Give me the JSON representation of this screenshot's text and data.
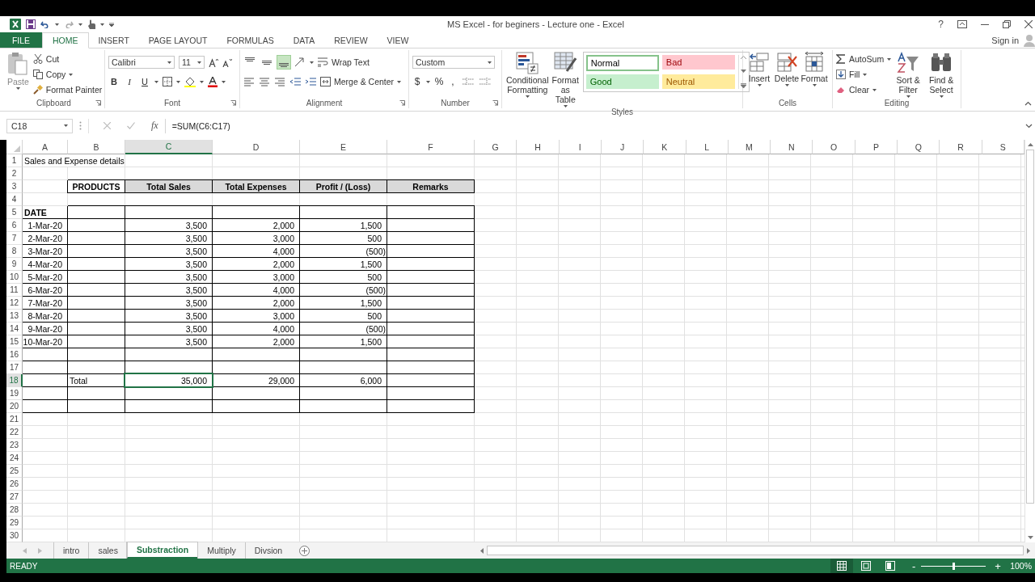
{
  "window": {
    "title": "MS Excel - for beginers - Lecture one - Excel",
    "help": "?",
    "sign_in": "Sign in"
  },
  "ribbon_tabs": [
    {
      "label": "FILE",
      "kind": "file",
      "selected": false
    },
    {
      "label": "HOME",
      "kind": "tab",
      "selected": true
    },
    {
      "label": "INSERT",
      "kind": "tab",
      "selected": false
    },
    {
      "label": "PAGE LAYOUT",
      "kind": "tab",
      "selected": false
    },
    {
      "label": "FORMULAS",
      "kind": "tab",
      "selected": false
    },
    {
      "label": "DATA",
      "kind": "tab",
      "selected": false
    },
    {
      "label": "REVIEW",
      "kind": "tab",
      "selected": false
    },
    {
      "label": "VIEW",
      "kind": "tab",
      "selected": false
    }
  ],
  "ribbon": [
    {
      "kind": "clipboard",
      "label": "Clipboard",
      "paste": "Paste",
      "cut": "Cut",
      "copy": "Copy",
      "format_painter": "Format Painter"
    },
    {
      "kind": "font",
      "label": "Font",
      "font": "Calibri",
      "size": "11",
      "styles": [
        "B",
        "I",
        "U"
      ]
    },
    {
      "kind": "alignment",
      "label": "Alignment",
      "vertical": [
        {
          "kind": "top",
          "selected": false
        },
        {
          "kind": "middle",
          "selected": false
        },
        {
          "kind": "bottom",
          "selected": true
        }
      ],
      "wrap": "Wrap Text",
      "merge": "Merge & Center"
    },
    {
      "kind": "number",
      "label": "Number",
      "format": "Custom",
      "symbols": [
        "$",
        "%",
        ","
      ]
    },
    {
      "kind": "styles",
      "label": "Styles",
      "conditional": "Conditional Formatting",
      "table": "Format as Table",
      "gallery": [
        {
          "text": "Normal",
          "kind": "normal",
          "selected": true
        },
        {
          "text": "Bad",
          "kind": "bad",
          "selected": false
        },
        {
          "text": "Good",
          "kind": "good",
          "selected": false
        },
        {
          "text": "Neutral",
          "kind": "neutral",
          "selected": false
        }
      ]
    },
    {
      "kind": "cells",
      "label": "Cells",
      "buttons": [
        {
          "text": "Insert",
          "kind": "insert"
        },
        {
          "text": "Delete",
          "kind": "delete"
        },
        {
          "text": "Format",
          "kind": "format"
        }
      ]
    },
    {
      "kind": "editing",
      "label": "Editing",
      "autosum": "AutoSum",
      "fill": "Fill",
      "clear": "Clear",
      "sort": "Sort & Filter",
      "find": "Find & Select"
    }
  ],
  "formula_bar": {
    "name_box": "C18",
    "fx": "fx",
    "formula": "=SUM(C6:C17)"
  },
  "sheet": {
    "columns": [
      {
        "label": "A",
        "selected": false
      },
      {
        "label": "B",
        "selected": false
      },
      {
        "label": "C",
        "selected": true
      },
      {
        "label": "D",
        "selected": false
      },
      {
        "label": "E",
        "selected": false
      },
      {
        "label": "F",
        "selected": false
      },
      {
        "label": "G",
        "selected": false
      },
      {
        "label": "H",
        "selected": false
      },
      {
        "label": "I",
        "selected": false
      },
      {
        "label": "J",
        "selected": false
      },
      {
        "label": "K",
        "selected": false
      },
      {
        "label": "L",
        "selected": false
      },
      {
        "label": "M",
        "selected": false
      },
      {
        "label": "N",
        "selected": false
      },
      {
        "label": "O",
        "selected": false
      },
      {
        "label": "P",
        "selected": false
      },
      {
        "label": "Q",
        "selected": false
      },
      {
        "label": "R",
        "selected": false
      },
      {
        "label": "S",
        "selected": false
      }
    ],
    "rows": [
      {
        "number": "1",
        "selected": false,
        "kind": "plain",
        "cells": [
          {
            "text": "Sales and Expense details",
            "kind": "label"
          }
        ]
      },
      {
        "number": "2",
        "selected": false,
        "kind": "plain"
      },
      {
        "number": "3",
        "selected": false,
        "kind": "header",
        "cells": [
          null,
          {
            "text": "PRODUCTS",
            "kind": "heading",
            "shaded": false
          },
          {
            "text": "Total Sales",
            "kind": "heading",
            "shaded": true
          },
          {
            "text": "Total Expenses",
            "kind": "heading",
            "shaded": true
          },
          {
            "text": "Profit / (Loss)",
            "kind": "heading",
            "shaded": true
          },
          {
            "text": "Remarks",
            "kind": "heading",
            "shaded": true
          }
        ]
      },
      {
        "number": "4",
        "selected": false,
        "kind": "plain"
      },
      {
        "number": "5",
        "selected": false,
        "kind": "boxed",
        "cells": [
          {
            "text": "DATE",
            "kind": "bold_label"
          }
        ]
      },
      {
        "number": "6",
        "selected": false,
        "kind": "boxed",
        "cells": [
          {
            "text": "1-Mar-20",
            "kind": "number"
          },
          null,
          {
            "text": "3,500",
            "kind": "number"
          },
          {
            "text": "2,000",
            "kind": "number"
          },
          {
            "text": "1,500",
            "kind": "number"
          }
        ]
      },
      {
        "number": "7",
        "selected": false,
        "kind": "boxed",
        "cells": [
          {
            "text": "2-Mar-20",
            "kind": "number"
          },
          null,
          {
            "text": "3,500",
            "kind": "number"
          },
          {
            "text": "3,000",
            "kind": "number"
          },
          {
            "text": "500",
            "kind": "number"
          }
        ]
      },
      {
        "number": "8",
        "selected": false,
        "kind": "boxed",
        "cells": [
          {
            "text": "3-Mar-20",
            "kind": "number"
          },
          null,
          {
            "text": "3,500",
            "kind": "number"
          },
          {
            "text": "4,000",
            "kind": "number"
          },
          {
            "text": "(500)",
            "kind": "negative"
          }
        ]
      },
      {
        "number": "9",
        "selected": false,
        "kind": "boxed",
        "cells": [
          {
            "text": "4-Mar-20",
            "kind": "number"
          },
          null,
          {
            "text": "3,500",
            "kind": "number"
          },
          {
            "text": "2,000",
            "kind": "number"
          },
          {
            "text": "1,500",
            "kind": "number"
          }
        ]
      },
      {
        "number": "10",
        "selected": false,
        "kind": "boxed",
        "cells": [
          {
            "text": "5-Mar-20",
            "kind": "number"
          },
          null,
          {
            "text": "3,500",
            "kind": "number"
          },
          {
            "text": "3,000",
            "kind": "number"
          },
          {
            "text": "500",
            "kind": "number"
          }
        ]
      },
      {
        "number": "11",
        "selected": false,
        "kind": "boxed",
        "cells": [
          {
            "text": "6-Mar-20",
            "kind": "number"
          },
          null,
          {
            "text": "3,500",
            "kind": "number"
          },
          {
            "text": "4,000",
            "kind": "number"
          },
          {
            "text": "(500)",
            "kind": "negative"
          }
        ]
      },
      {
        "number": "12",
        "selected": false,
        "kind": "boxed",
        "cells": [
          {
            "text": "7-Mar-20",
            "kind": "number"
          },
          null,
          {
            "text": "3,500",
            "kind": "number"
          },
          {
            "text": "2,000",
            "kind": "number"
          },
          {
            "text": "1,500",
            "kind": "number"
          }
        ]
      },
      {
        "number": "13",
        "selected": false,
        "kind": "boxed",
        "cells": [
          {
            "text": "8-Mar-20",
            "kind": "number"
          },
          null,
          {
            "text": "3,500",
            "kind": "number"
          },
          {
            "text": "3,000",
            "kind": "number"
          },
          {
            "text": "500",
            "kind": "number"
          }
        ]
      },
      {
        "number": "14",
        "selected": false,
        "kind": "boxed",
        "cells": [
          {
            "text": "9-Mar-20",
            "kind": "number"
          },
          null,
          {
            "text": "3,500",
            "kind": "number"
          },
          {
            "text": "4,000",
            "kind": "number"
          },
          {
            "text": "(500)",
            "kind": "negative"
          }
        ]
      },
      {
        "number": "15",
        "selected": false,
        "kind": "boxed",
        "cells": [
          {
            "text": "10-Mar-20",
            "kind": "number"
          },
          null,
          {
            "text": "3,500",
            "kind": "number"
          },
          {
            "text": "2,000",
            "kind": "number"
          },
          {
            "text": "1,500",
            "kind": "number"
          }
        ]
      },
      {
        "number": "16",
        "selected": false,
        "kind": "boxed"
      },
      {
        "number": "17",
        "selected": false,
        "kind": "boxed"
      },
      {
        "number": "18",
        "selected": true,
        "kind": "boxed",
        "cells": [
          null,
          {
            "text": "Total",
            "kind": "label"
          },
          {
            "text": "35,000",
            "kind": "number"
          },
          {
            "text": "29,000",
            "kind": "number"
          },
          {
            "text": "6,000",
            "kind": "number"
          }
        ]
      },
      {
        "number": "19",
        "selected": false,
        "kind": "boxed"
      },
      {
        "number": "20",
        "selected": false,
        "kind": "boxed"
      },
      {
        "number": "21",
        "selected": false,
        "kind": "plain"
      },
      {
        "number": "22",
        "selected": false,
        "kind": "plain"
      },
      {
        "number": "23",
        "selected": false,
        "kind": "plain"
      },
      {
        "number": "24",
        "selected": false,
        "kind": "plain"
      },
      {
        "number": "25",
        "selected": false,
        "kind": "plain"
      },
      {
        "number": "26",
        "selected": false,
        "kind": "plain"
      },
      {
        "number": "27",
        "selected": false,
        "kind": "plain"
      },
      {
        "number": "28",
        "selected": false,
        "kind": "plain"
      },
      {
        "number": "29",
        "selected": false,
        "kind": "plain"
      },
      {
        "number": "30",
        "selected": false,
        "kind": "plain"
      }
    ]
  },
  "sheet_tabs": [
    {
      "label": "intro",
      "selected": false
    },
    {
      "label": "sales",
      "selected": false
    },
    {
      "label": "Substraction",
      "selected": true
    },
    {
      "label": "Multiply",
      "selected": false
    },
    {
      "label": "Divsion",
      "selected": false
    }
  ],
  "status_bar": {
    "mode": "READY",
    "views": [
      {
        "kind": "normal",
        "selected": true
      },
      {
        "kind": "page_layout",
        "selected": false
      },
      {
        "kind": "page_break",
        "selected": false
      }
    ],
    "zoom_out": "-",
    "zoom": {
      "level": 0.5
    },
    "zoom_in": "+",
    "zoom_percent": "100%"
  }
}
